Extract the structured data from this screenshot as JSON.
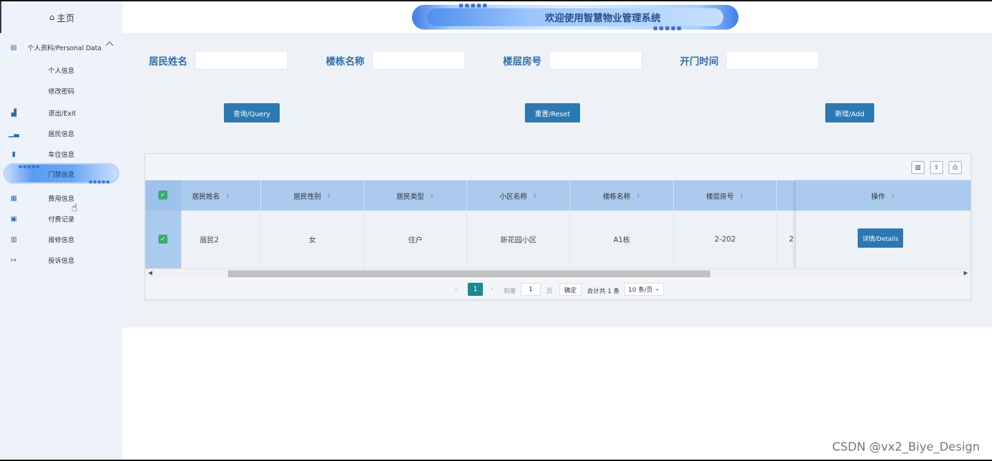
{
  "sidebar": {
    "home": "主页",
    "group": {
      "label": "个人资料/Personal Data",
      "items": [
        "个人信息",
        "修改密码"
      ]
    },
    "items": [
      {
        "label": "退出/Exit",
        "icon": "stats-icon"
      },
      {
        "label": "居民信息",
        "icon": "chart-icon"
      },
      {
        "label": "车位信息",
        "icon": "bookmark-icon"
      },
      {
        "label": "门禁信息",
        "icon": "door-icon",
        "active": true
      },
      {
        "label": "费用信息",
        "icon": "calendar-icon"
      },
      {
        "label": "付费记录",
        "icon": "calendar-check-icon"
      },
      {
        "label": "报修信息",
        "icon": "book-icon"
      },
      {
        "label": "投诉信息",
        "icon": "logout-icon"
      }
    ]
  },
  "header": {
    "title": "欢迎使用智慧物业管理系统"
  },
  "search": {
    "fields": [
      {
        "label": "居民姓名",
        "value": ""
      },
      {
        "label": "楼栋名称",
        "value": ""
      },
      {
        "label": "楼层房号",
        "value": ""
      },
      {
        "label": "开门时间",
        "value": ""
      }
    ],
    "buttons": {
      "query": "查询/Query",
      "reset": "重置/Reset",
      "add": "新增/Add"
    }
  },
  "table": {
    "columns": [
      "居民姓名",
      "居民性别",
      "居民类型",
      "小区名称",
      "楼栋名称",
      "楼层房号"
    ],
    "action_column": "操作",
    "rows": [
      {
        "cells": [
          "居民2",
          "女",
          "住户",
          "新花园小区",
          "A1栋",
          "2-202"
        ],
        "partial": "2",
        "action": "详情/Details"
      }
    ]
  },
  "pagination": {
    "current_page": "1",
    "goto_label": "到第",
    "goto_value": "1",
    "page_label": "页",
    "confirm": "确定",
    "total": "合计共 1 条",
    "page_size": "10 条/页"
  },
  "watermark": "CSDN @vx2_Biye_Design",
  "colors": {
    "primary": "#2b78b2",
    "header_row": "#aacaee",
    "page_active": "#1b8a8f",
    "label": "#2e6ea8"
  }
}
